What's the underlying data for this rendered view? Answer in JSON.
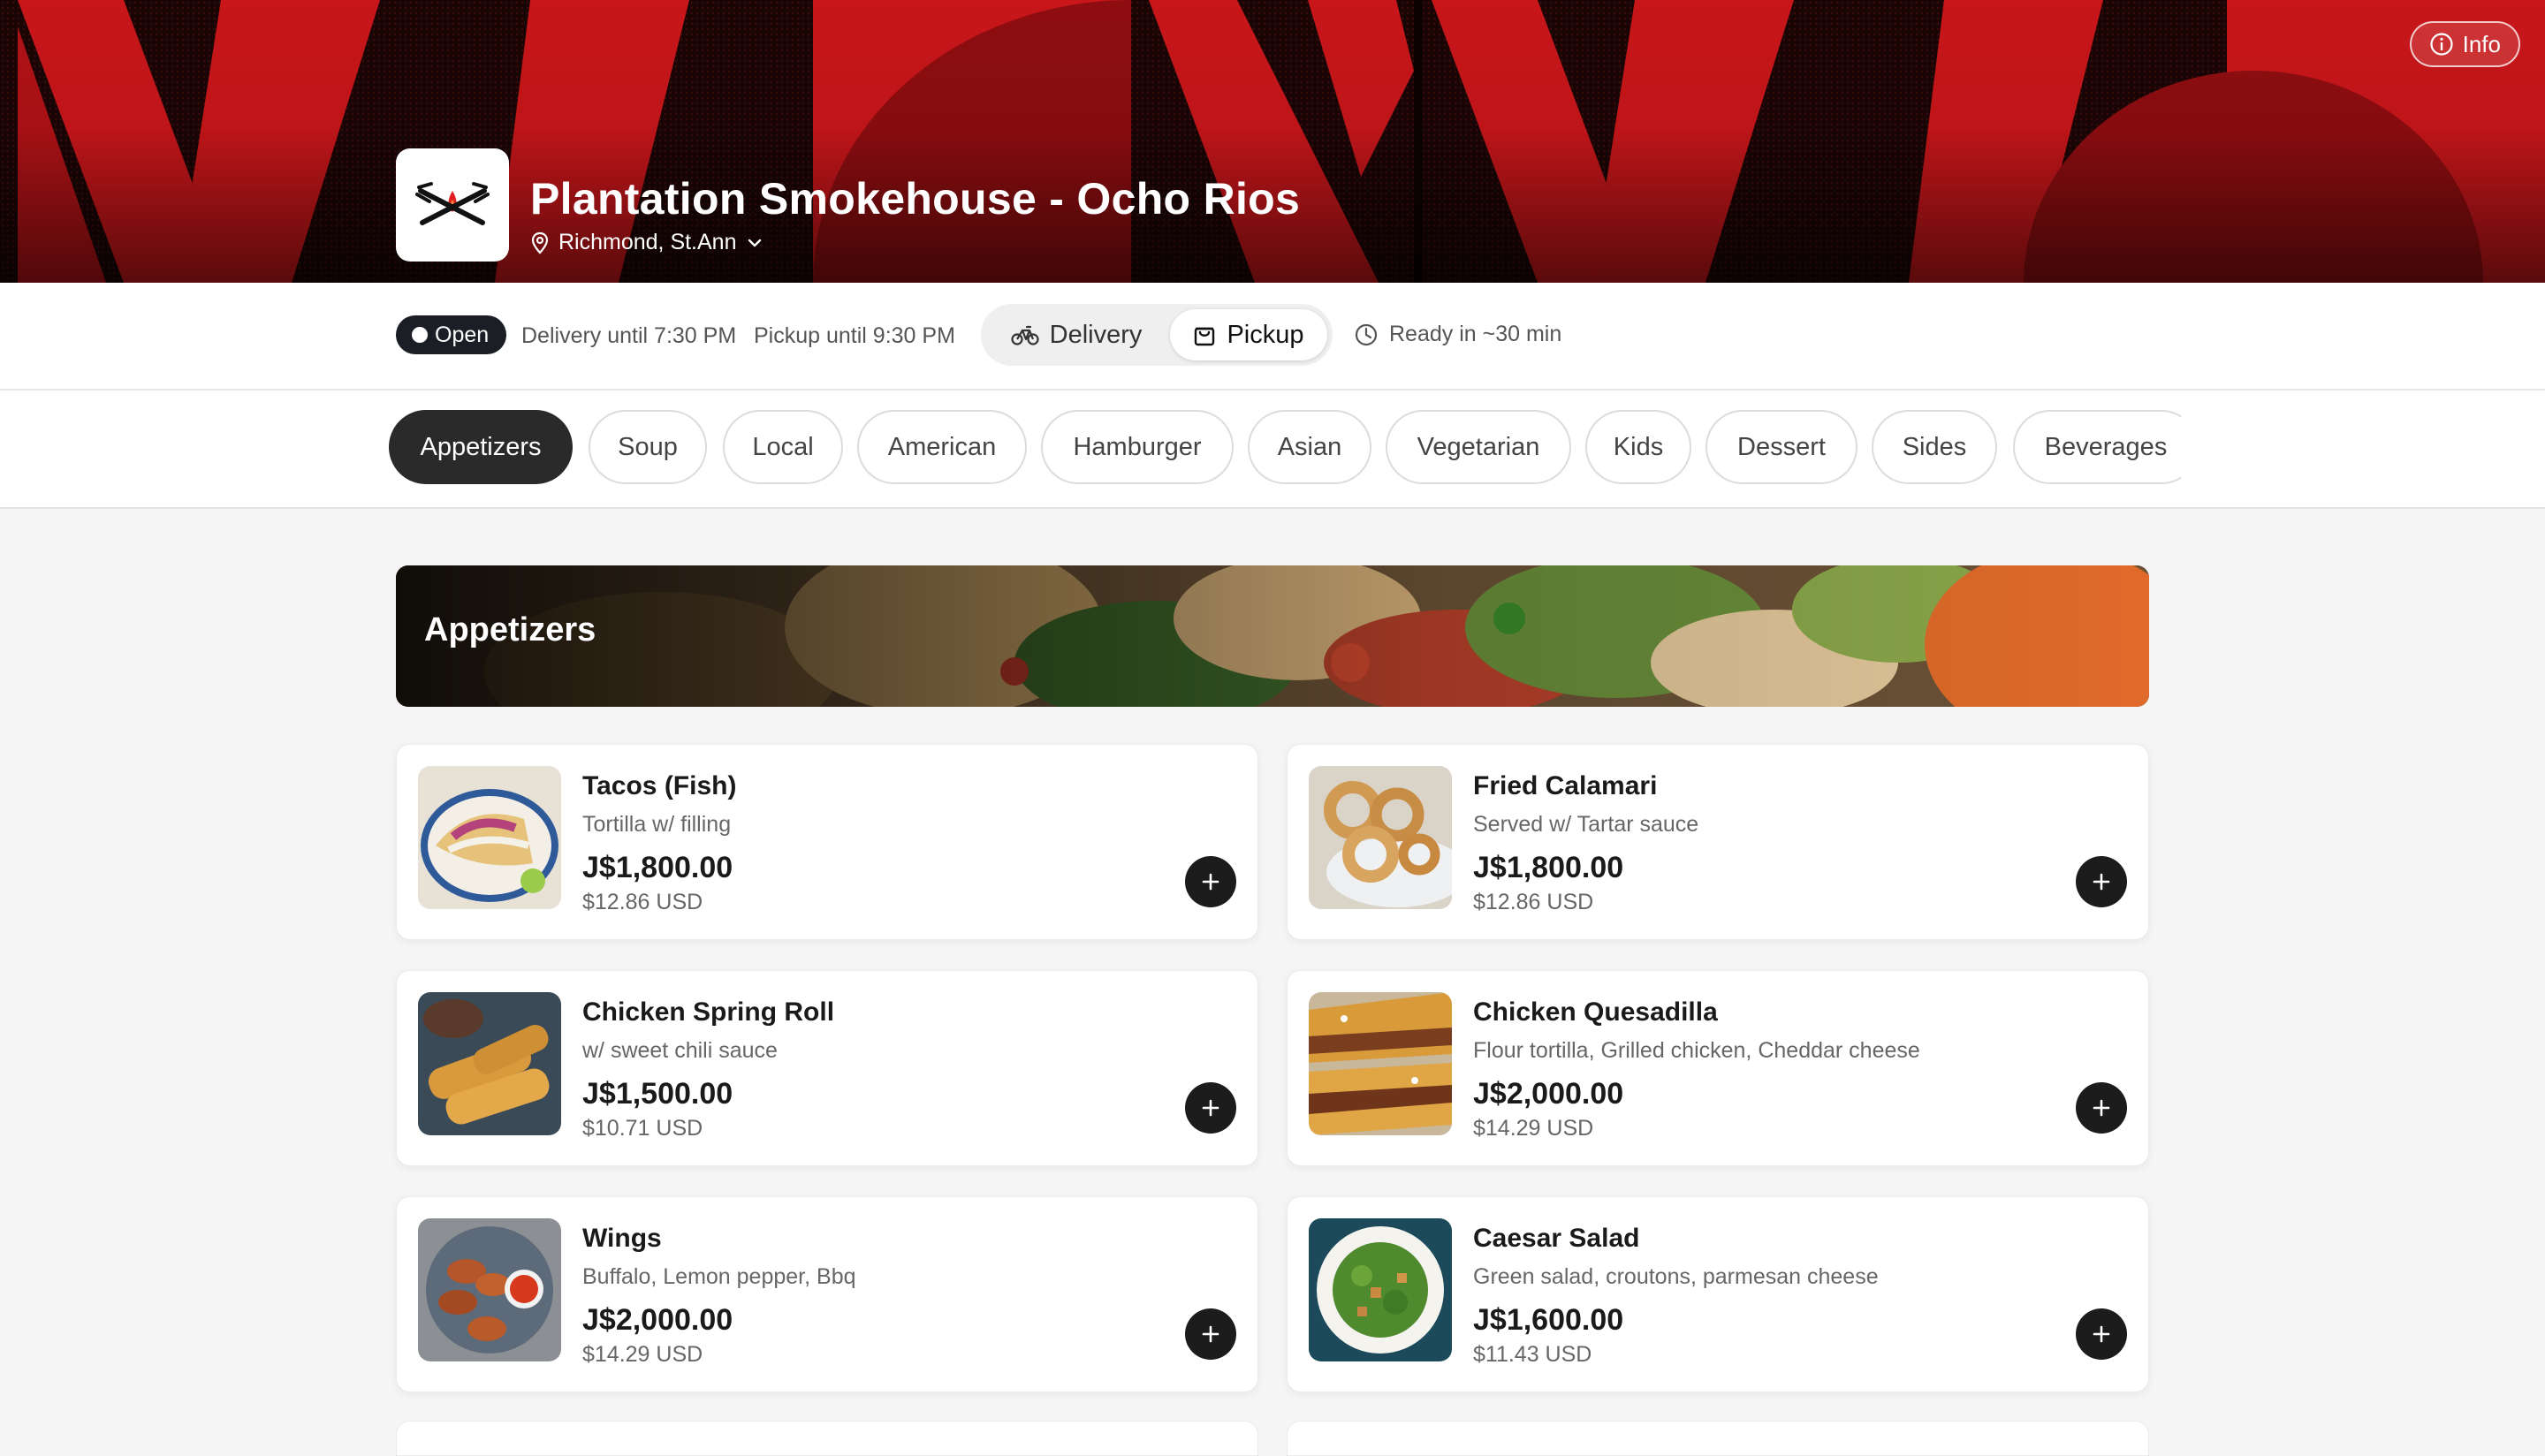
{
  "header": {
    "store_name": "Plantation Smokehouse - Ocho Rios",
    "location": "Richmond, St.Ann",
    "info_label": "Info",
    "logo_icon": "crossed-tongs-flame-icon"
  },
  "status": {
    "open_label": "Open",
    "delivery_hours": "Delivery until 7:30 PM",
    "pickup_hours": "Pickup until 9:30 PM",
    "ready_time": "Ready in ~30 min"
  },
  "mode": {
    "options": [
      "Delivery",
      "Pickup"
    ],
    "selected": "Pickup"
  },
  "categories": {
    "items": [
      "Appetizers",
      "Soup",
      "Local",
      "American",
      "Hamburger",
      "Asian",
      "Vegetarian",
      "Kids",
      "Dessert",
      "Sides",
      "Beverages"
    ],
    "active": "Appetizers"
  },
  "section": {
    "title": "Appetizers"
  },
  "menu": {
    "items": [
      {
        "name": "Tacos (Fish)",
        "description": "Tortilla w/ filling",
        "price": "J$1,800.00",
        "usd": "$12.86 USD"
      },
      {
        "name": "Fried Calamari",
        "description": "Served w/ Tartar sauce",
        "price": "J$1,800.00",
        "usd": "$12.86 USD"
      },
      {
        "name": "Chicken Spring Roll",
        "description": "w/ sweet chili sauce",
        "price": "J$1,500.00",
        "usd": "$10.71 USD"
      },
      {
        "name": "Chicken Quesadilla",
        "description": "Flour tortilla, Grilled chicken, Cheddar cheese",
        "price": "J$2,000.00",
        "usd": "$14.29 USD"
      },
      {
        "name": "Wings",
        "description": "Buffalo, Lemon pepper, Bbq",
        "price": "J$2,000.00",
        "usd": "$14.29 USD"
      },
      {
        "name": "Caesar Salad",
        "description": "Green salad, croutons, parmesan cheese",
        "price": "J$1,600.00",
        "usd": "$11.43 USD"
      }
    ]
  },
  "colors": {
    "hero_red": "#c8161a",
    "dark": "#1c1e26",
    "accent_button": "#1c1c1c"
  }
}
